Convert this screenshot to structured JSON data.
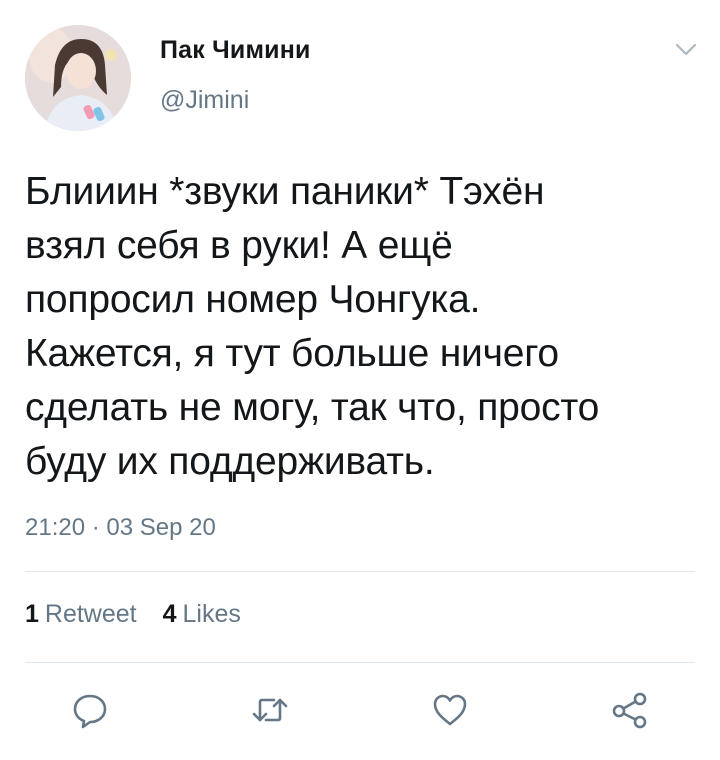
{
  "user": {
    "display_name": "Пак Чимини",
    "handle": "@Jimini"
  },
  "tweet": {
    "text": "Блииин *звуки паники* Тэхён\nвзял себя в руки! А ещё\nпопросил номер Чонгука.\nКажется, я тут больше ничего\nсделать не могу, так что, просто\nбуду их поддерживать.",
    "timestamp": "21:20 · 03 Sep 20"
  },
  "stats": {
    "retweets_count": "1",
    "retweets_label": "Retweet",
    "likes_count": "4",
    "likes_label": "Likes"
  },
  "icons": {
    "caret": "chevron-down-icon",
    "reply": "reply-icon",
    "retweet": "retweet-icon",
    "like": "heart-icon",
    "share": "share-icon"
  },
  "colors": {
    "text_primary": "#14171a",
    "text_secondary": "#657786",
    "icon": "#657786",
    "divider": "#e1e8ed"
  }
}
